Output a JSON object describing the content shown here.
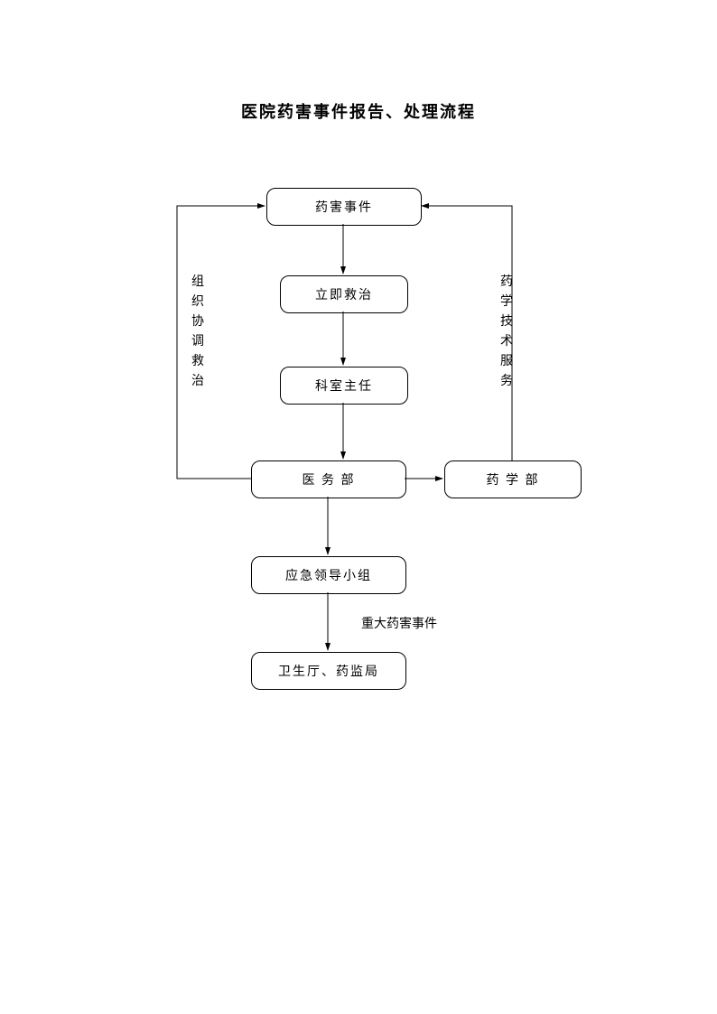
{
  "title": "医院药害事件报告、处理流程",
  "nodes": {
    "n1": "药害事件",
    "n2": "立即救治",
    "n3": "科室主任",
    "n4": "医 务 部",
    "n5": "药 学 部",
    "n6": "应急领导小组",
    "n7": "卫生厅、药监局"
  },
  "edgeLabels": {
    "left": "组织协调救治",
    "right": "药学技术服务",
    "major": "重大药害事件"
  },
  "chart_data": {
    "type": "flowchart",
    "title": "医院药害事件报告、处理流程",
    "nodes": [
      {
        "id": "n1",
        "label": "药害事件"
      },
      {
        "id": "n2",
        "label": "立即救治"
      },
      {
        "id": "n3",
        "label": "科室主任"
      },
      {
        "id": "n4",
        "label": "医务部"
      },
      {
        "id": "n5",
        "label": "药学部"
      },
      {
        "id": "n6",
        "label": "应急领导小组"
      },
      {
        "id": "n7",
        "label": "卫生厅、药监局"
      }
    ],
    "edges": [
      {
        "from": "n1",
        "to": "n2"
      },
      {
        "from": "n2",
        "to": "n3"
      },
      {
        "from": "n3",
        "to": "n4"
      },
      {
        "from": "n4",
        "to": "n5"
      },
      {
        "from": "n4",
        "to": "n6"
      },
      {
        "from": "n6",
        "to": "n7",
        "label": "重大药害事件"
      },
      {
        "from": "n4",
        "to": "n1",
        "label": "组织协调救治"
      },
      {
        "from": "n5",
        "to": "n1",
        "label": "药学技术服务"
      }
    ]
  }
}
